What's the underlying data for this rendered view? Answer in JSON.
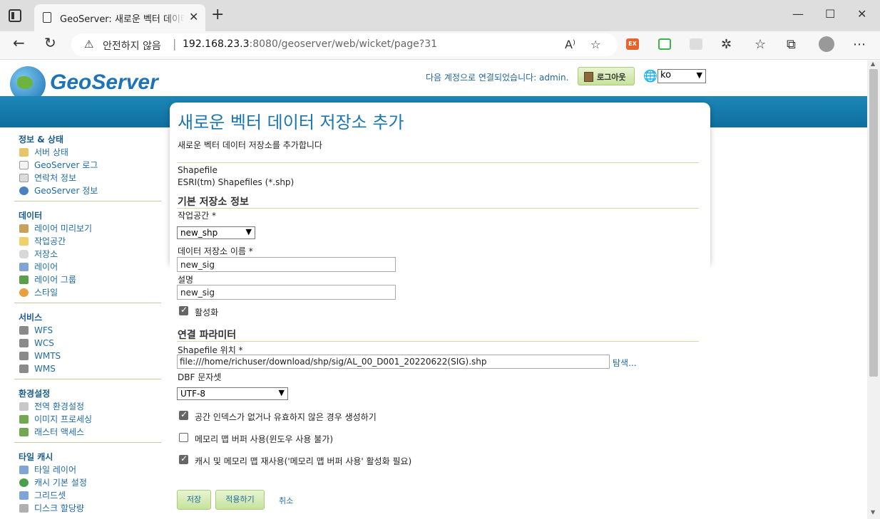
{
  "browser": {
    "tab_title": "GeoServer: 새로운 벡터 데이터 저장소 추가",
    "security_label": "안전하지 않음",
    "url_host": "192.168.23.3",
    "url_path": ":8080/geoserver/web/wicket/page?31"
  },
  "header": {
    "logo_text": "GeoServer",
    "login_text": "다음 계정으로 연결되었습니다: admin.",
    "logout_label": "로그아웃",
    "language": "ko"
  },
  "sidebar": {
    "sections": [
      {
        "title": "정보 & 상태",
        "items": [
          "서버 상태",
          "GeoServer 로그",
          "연락처 정보",
          "GeoServer 정보"
        ]
      },
      {
        "title": "데이터",
        "items": [
          "레이어 미리보기",
          "작업공간",
          "저장소",
          "레이어",
          "레이어 그룹",
          "스타일"
        ]
      },
      {
        "title": "서비스",
        "items": [
          "WFS",
          "WCS",
          "WMTS",
          "WMS"
        ]
      },
      {
        "title": "환경설정",
        "items": [
          "전역 환경설정",
          "이미지 프로세싱",
          "래스터 액세스"
        ]
      },
      {
        "title": "타일 캐시",
        "items": [
          "타일 레이어",
          "캐시 기본 설정",
          "그리드셋",
          "디스크 할당량"
        ]
      }
    ]
  },
  "main": {
    "title": "새로운 벡터 데이터 저장소 추가",
    "description": "새로운 벡터 데이터 저장소를 추가합니다",
    "store_type": "Shapefile",
    "store_type_desc": "ESRI(tm) Shapefiles (*.shp)",
    "basic_section": "기본 저장소 정보",
    "workspace_label": "작업공간 *",
    "workspace_value": "new_shp",
    "name_label": "데이터 저장소 이름 *",
    "name_value": "new_sig",
    "desc_label": "설명",
    "desc_value": "new_sig",
    "enabled_label": "활성화",
    "conn_section": "연결 파라미터",
    "shapefile_label": "Shapefile 위치 *",
    "shapefile_value": "file:///home/richuser/download/shp/sig/AL_00_D001_20220622(SIG).shp",
    "browse_label": "탐색...",
    "dbf_label": "DBF 문자셋",
    "dbf_value": "UTF-8",
    "opt1_label": "공간 인덱스가 없거나 유효하지 않은 경우 생성하기",
    "opt2_label": "메모리 맵 버퍼 사용(윈도우 사용 불가)",
    "opt3_label": "캐시 및 메모리 맵 재사용('메모리 맵 버퍼 사용' 활성화 필요)",
    "save_label": "저장",
    "apply_label": "적용하기",
    "cancel_label": "취소"
  }
}
